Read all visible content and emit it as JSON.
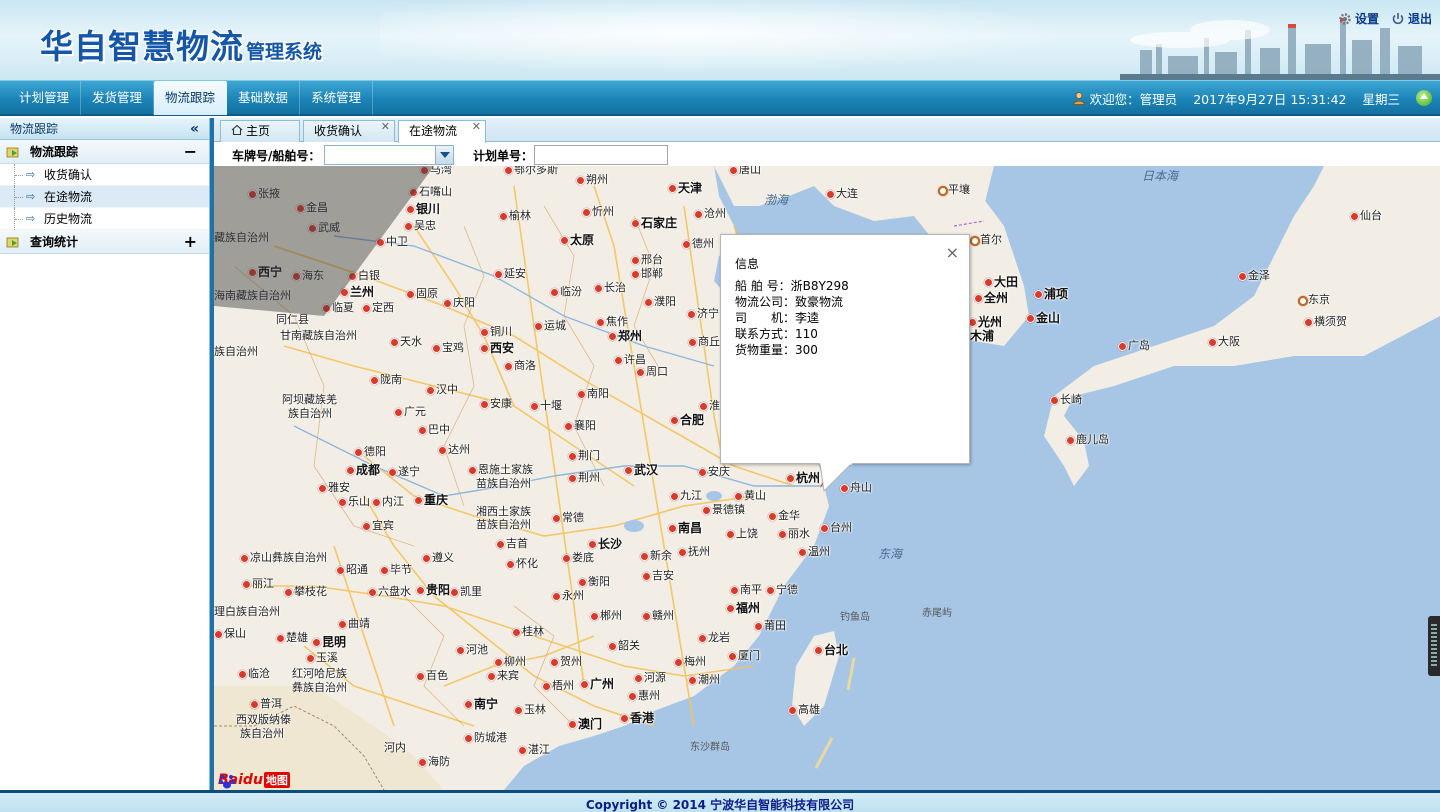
{
  "header": {
    "logo_main": "华自智慧物流",
    "logo_sub": "管理系统",
    "settings_label": "设置",
    "logout_label": "退出"
  },
  "nav": {
    "tabs": [
      {
        "label": "计划管理"
      },
      {
        "label": "发货管理"
      },
      {
        "label": "物流跟踪"
      },
      {
        "label": "基础数据"
      },
      {
        "label": "系统管理"
      }
    ],
    "active_index": 2,
    "welcome": "欢迎您：管理员",
    "datetime": "2017年9月27日 15:31:42",
    "weekday": "星期三"
  },
  "sidebar": {
    "title": "物流跟踪",
    "collapse_glyph": "«",
    "groups": [
      {
        "label": "物流跟踪",
        "toggle": "−",
        "items": [
          {
            "label": "收货确认"
          },
          {
            "label": "在途物流"
          },
          {
            "label": "历史物流"
          }
        ]
      },
      {
        "label": "查询统计",
        "toggle": "+"
      }
    ],
    "active_item": "在途物流"
  },
  "tabs": [
    {
      "label": "主页",
      "closable": false
    },
    {
      "label": "收货确认",
      "closable": true
    },
    {
      "label": "在途物流",
      "closable": true
    }
  ],
  "filter": {
    "vessel_label": "车牌号/船舶号：",
    "vessel_value": "",
    "plan_label": "计划单号：",
    "plan_value": ""
  },
  "popup": {
    "title": "信息",
    "close": "×",
    "rows": [
      {
        "label": "船 舶 号：",
        "value": "浙B8Y298"
      },
      {
        "label": "物流公司：",
        "value": "致豪物流"
      },
      {
        "label": "司　　机：",
        "value": "李逵"
      },
      {
        "label": "联系方式：",
        "value": "110"
      },
      {
        "label": "货物重量：",
        "value": "300"
      }
    ]
  },
  "map": {
    "labels": [
      {
        "t": "马湾"
      },
      {
        "t": "鄂尔多斯"
      },
      {
        "t": "朔州"
      },
      {
        "t": "唐山"
      },
      {
        "t": "张掖"
      },
      {
        "t": "石嘴山"
      },
      {
        "t": "天津"
      },
      {
        "t": "金昌"
      },
      {
        "t": "银川"
      },
      {
        "t": "榆林"
      },
      {
        "t": "忻州"
      },
      {
        "t": "沧州"
      },
      {
        "t": "武威"
      },
      {
        "t": "吴忠"
      },
      {
        "t": "石家庄"
      },
      {
        "t": "中卫"
      },
      {
        "t": "太原"
      },
      {
        "t": "德州"
      },
      {
        "t": "藏族自治州"
      },
      {
        "t": "西宁"
      },
      {
        "t": "海东"
      },
      {
        "t": "白银"
      },
      {
        "t": "延安"
      },
      {
        "t": "邢台"
      },
      {
        "t": "邯郸"
      },
      {
        "t": "兰州"
      },
      {
        "t": "临汾"
      },
      {
        "t": "长治"
      },
      {
        "t": "固原"
      },
      {
        "t": "庆阳"
      },
      {
        "t": "濮阳"
      },
      {
        "t": "海南藏族自治州"
      },
      {
        "t": "临夏"
      },
      {
        "t": "定西"
      },
      {
        "t": "同仁县"
      },
      {
        "t": "甘南藏族自治州"
      },
      {
        "t": "铜川"
      },
      {
        "t": "运城"
      },
      {
        "t": "焦作"
      },
      {
        "t": "济宁"
      },
      {
        "t": "天水"
      },
      {
        "t": "宝鸡"
      },
      {
        "t": "西安"
      },
      {
        "t": "郑州"
      },
      {
        "t": "族自治州"
      },
      {
        "t": "商洛"
      },
      {
        "t": "许昌"
      },
      {
        "t": "商丘"
      },
      {
        "t": "周口"
      },
      {
        "t": "陇南"
      },
      {
        "t": "汉中"
      },
      {
        "t": "南阳"
      },
      {
        "t": "阿坝藏族羌"
      },
      {
        "t": "族自治州"
      },
      {
        "t": "安康"
      },
      {
        "t": "十堰"
      },
      {
        "t": "淮"
      },
      {
        "t": "广元"
      },
      {
        "t": "合肥"
      },
      {
        "t": "襄阳"
      },
      {
        "t": "巴中"
      },
      {
        "t": "达州"
      },
      {
        "t": "德阳"
      },
      {
        "t": "荆门"
      },
      {
        "t": "恩施土家族"
      },
      {
        "t": "苗族自治州"
      },
      {
        "t": "成都"
      },
      {
        "t": "遂宁"
      },
      {
        "t": "武汉"
      },
      {
        "t": "安庆"
      },
      {
        "t": "荆州"
      },
      {
        "t": "杭州"
      },
      {
        "t": "舟山"
      },
      {
        "t": "雅安"
      },
      {
        "t": "乐山"
      },
      {
        "t": "内江"
      },
      {
        "t": "重庆"
      },
      {
        "t": "九江"
      },
      {
        "t": "黄山"
      },
      {
        "t": "湘西土家族"
      },
      {
        "t": "苗族自治州"
      },
      {
        "t": "常德"
      },
      {
        "t": "景德镇"
      },
      {
        "t": "金华"
      },
      {
        "t": "台州"
      },
      {
        "t": "宜宾"
      },
      {
        "t": "南昌"
      },
      {
        "t": "吉首"
      },
      {
        "t": "长沙"
      },
      {
        "t": "上饶"
      },
      {
        "t": "丽水"
      },
      {
        "t": "凉山彝族自治州"
      },
      {
        "t": "遵义"
      },
      {
        "t": "怀化"
      },
      {
        "t": "娄底"
      },
      {
        "t": "新余"
      },
      {
        "t": "抚州"
      },
      {
        "t": "温州"
      },
      {
        "t": "昭通"
      },
      {
        "t": "毕节"
      },
      {
        "t": "丽江"
      },
      {
        "t": "衡阳"
      },
      {
        "t": "吉安"
      },
      {
        "t": "攀枝花"
      },
      {
        "t": "六盘水"
      },
      {
        "t": "贵阳"
      },
      {
        "t": "凯里"
      },
      {
        "t": "永州"
      },
      {
        "t": "南平"
      },
      {
        "t": "宁德"
      },
      {
        "t": "理白族自治州"
      },
      {
        "t": "曲靖"
      },
      {
        "t": "郴州"
      },
      {
        "t": "赣州"
      },
      {
        "t": "福州"
      },
      {
        "t": "保山"
      },
      {
        "t": "楚雄"
      },
      {
        "t": "昆明"
      },
      {
        "t": "桂林"
      },
      {
        "t": "龙岩"
      },
      {
        "t": "莆田"
      },
      {
        "t": "玉溪"
      },
      {
        "t": "河池"
      },
      {
        "t": "韶关"
      },
      {
        "t": "梅州"
      },
      {
        "t": "厦门"
      },
      {
        "t": "临沧"
      },
      {
        "t": "红河哈尼族"
      },
      {
        "t": "彝族自治州"
      },
      {
        "t": "柳州"
      },
      {
        "t": "贺州"
      },
      {
        "t": "河源"
      },
      {
        "t": "百色"
      },
      {
        "t": "来宾"
      },
      {
        "t": "梧州"
      },
      {
        "t": "广州"
      },
      {
        "t": "惠州"
      },
      {
        "t": "潮州"
      },
      {
        "t": "普洱"
      },
      {
        "t": "南宁"
      },
      {
        "t": "玉林"
      },
      {
        "t": "澳门"
      },
      {
        "t": "香港"
      },
      {
        "t": "西双版纳傣"
      },
      {
        "t": "族自治州"
      },
      {
        "t": "防城港"
      },
      {
        "t": "湛江"
      },
      {
        "t": "河内"
      },
      {
        "t": "海防"
      },
      {
        "t": "台北"
      },
      {
        "t": "高雄"
      },
      {
        "t": "大连"
      },
      {
        "t": "平壤"
      },
      {
        "t": "首尔"
      },
      {
        "t": "大田"
      },
      {
        "t": "全州"
      },
      {
        "t": "浦项"
      },
      {
        "t": "光州"
      },
      {
        "t": "金山"
      },
      {
        "t": "木浦"
      },
      {
        "t": "金泽"
      },
      {
        "t": "东京"
      },
      {
        "t": "横须贺"
      },
      {
        "t": "仙台"
      },
      {
        "t": "广岛"
      },
      {
        "t": "大阪"
      },
      {
        "t": "长崎"
      },
      {
        "t": "鹿儿岛"
      },
      {
        "t": "渤海"
      },
      {
        "t": "日本海"
      },
      {
        "t": "东海"
      },
      {
        "t": "钓鱼岛"
      },
      {
        "t": "赤尾屿"
      },
      {
        "t": "东沙群岛"
      }
    ],
    "baidu_text": "Bai",
    "baidu_du": "du",
    "baidu_map": "地图"
  },
  "footer": {
    "copyright": "Copyright © 2014 宁波华自智能科技有限公司"
  }
}
